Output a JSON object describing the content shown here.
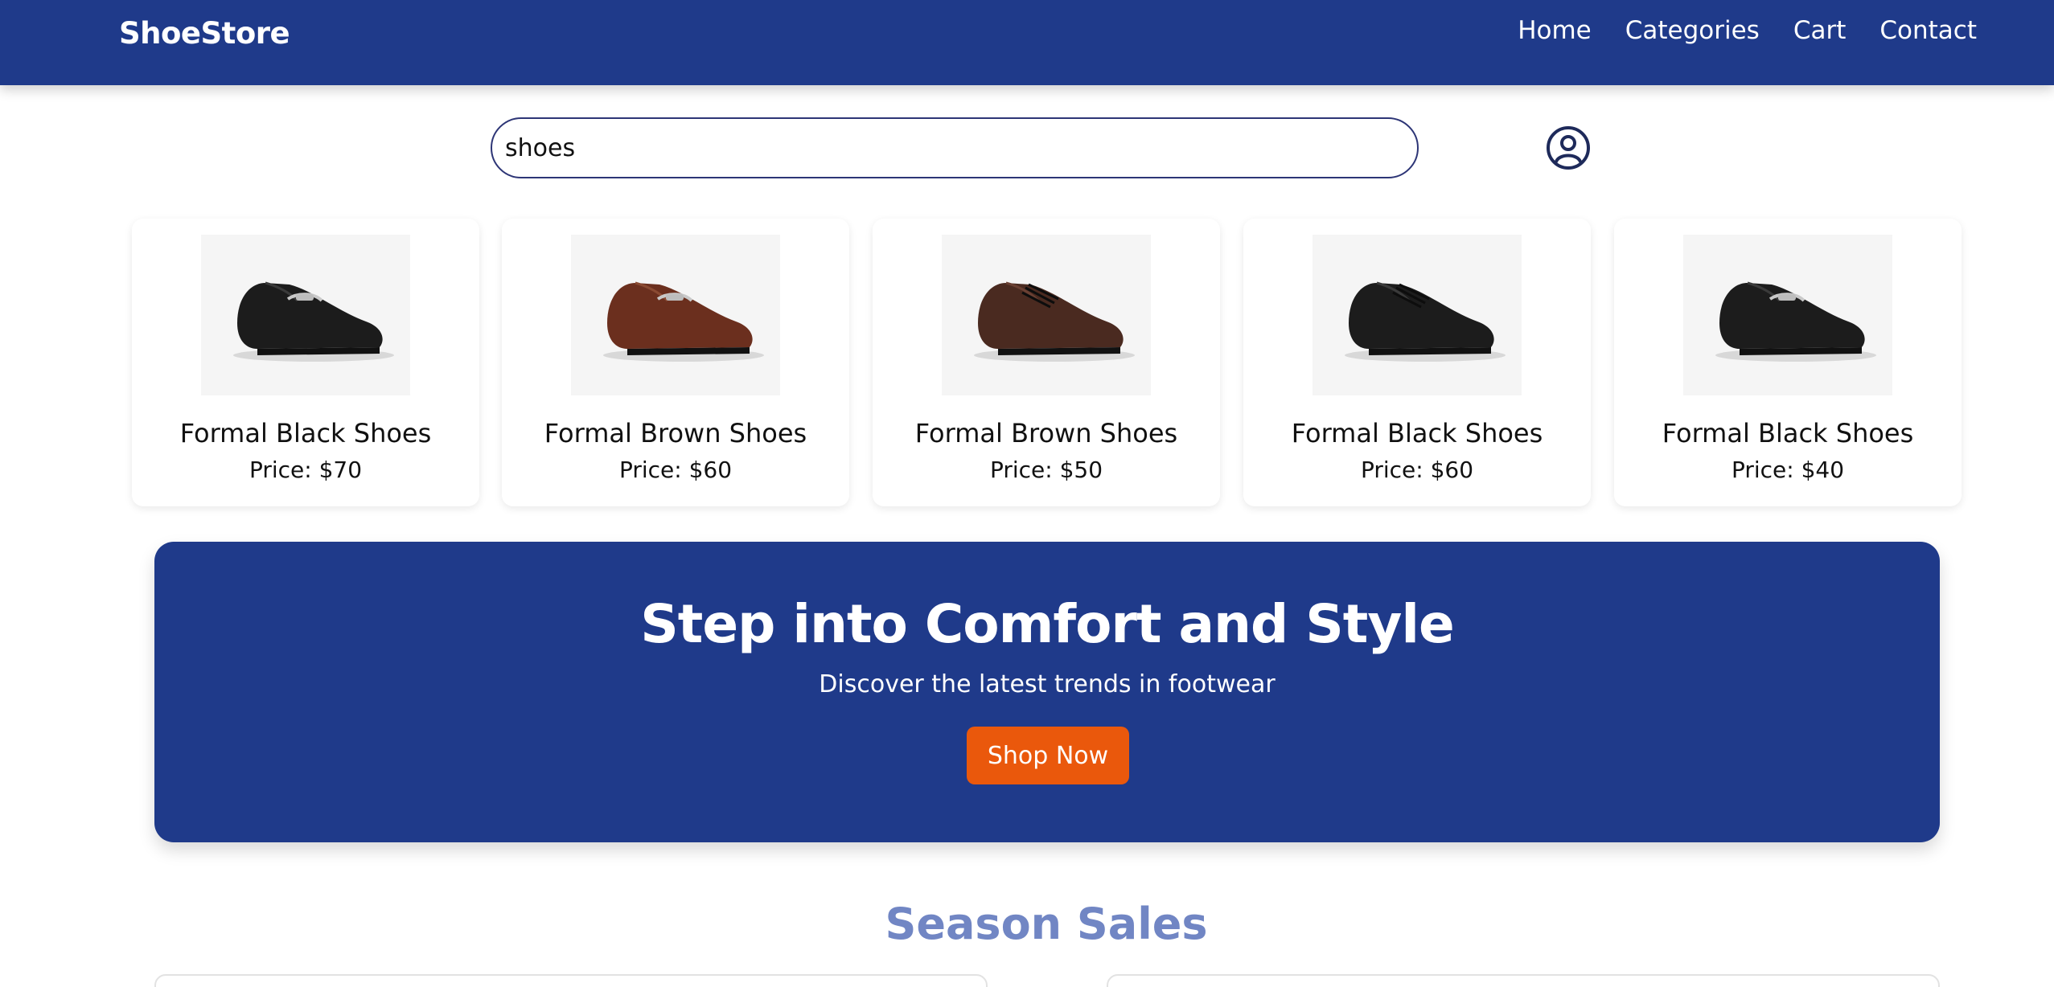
{
  "navbar": {
    "brand": "ShoeStore",
    "links": [
      "Home",
      "Categories",
      "Cart",
      "Contact"
    ],
    "bg_color": "#1f3a8a"
  },
  "search": {
    "value": "shoes",
    "user_icon": "user-circle-icon"
  },
  "products": [
    {
      "name": "Formal Black Shoes",
      "price": "Price: $70",
      "color": "black",
      "style": "loafer"
    },
    {
      "name": "Formal Brown Shoes",
      "price": "Price: $60",
      "color": "brown",
      "style": "loafer"
    },
    {
      "name": "Formal Brown Shoes",
      "price": "Price: $50",
      "color": "darkbrown",
      "style": "derby"
    },
    {
      "name": "Formal Black Shoes",
      "price": "Price: $60",
      "color": "black",
      "style": "derby"
    },
    {
      "name": "Formal Black Shoes",
      "price": "Price: $40",
      "color": "black",
      "style": "loafer"
    }
  ],
  "hero": {
    "title": "Step into Comfort and Style",
    "subtitle": "Discover the latest trends in footwear",
    "button": "Shop Now",
    "button_color": "#ea580c"
  },
  "season": {
    "title": "Season Sales",
    "title_color": "#7186c4"
  }
}
